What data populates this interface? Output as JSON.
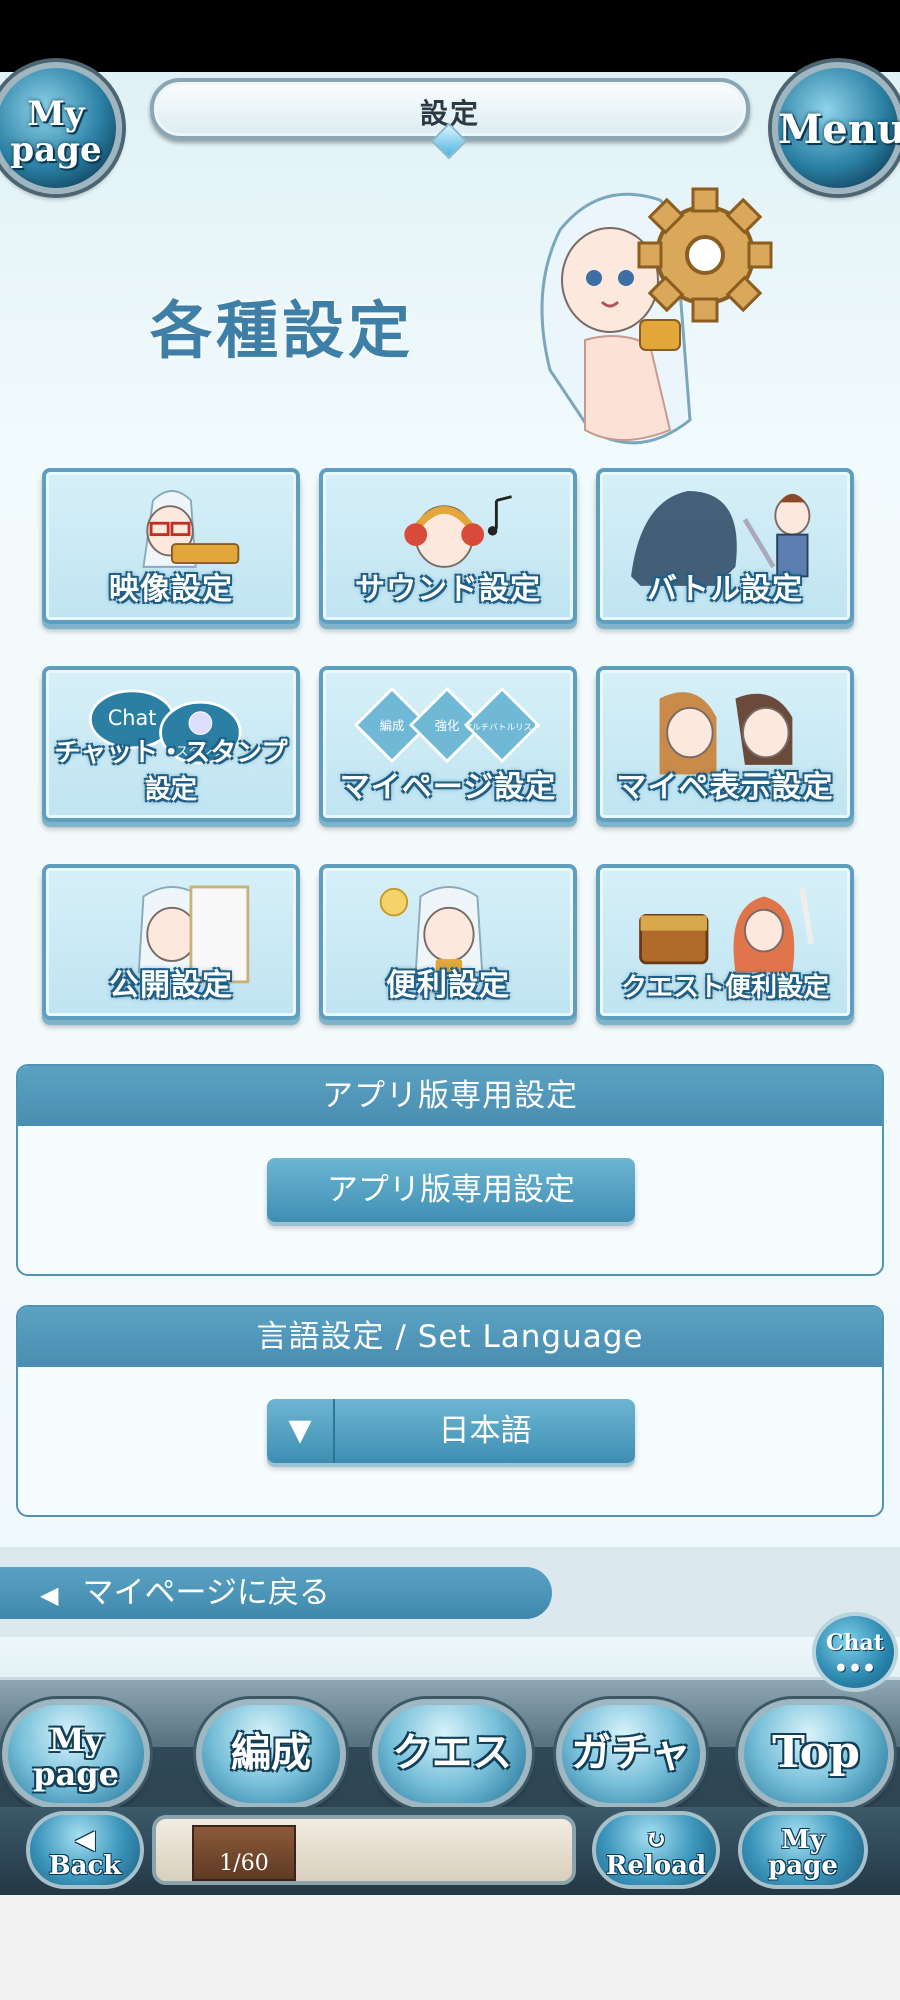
{
  "header": {
    "title": "設定",
    "mypage_orb": [
      "My",
      "page"
    ],
    "menu_orb": "Menu"
  },
  "hero": {
    "title": "各種設定"
  },
  "tiles": [
    {
      "label": "映像設定",
      "icon": "glasses-character-icon"
    },
    {
      "label": "サウンド設定",
      "icon": "headphones-character-icon"
    },
    {
      "label": "バトル設定",
      "icon": "battle-characters-icon"
    },
    {
      "label": "チャット・スタンプ設定",
      "icon": "chat-stamp-icon",
      "chat": "Chat",
      "stamp": "スタンプ"
    },
    {
      "label": "マイページ設定",
      "icon": "mypage-diamonds-icon",
      "diamonds": [
        "編成",
        "強化",
        "マルチバトルリスト"
      ]
    },
    {
      "label": "マイペ表示設定",
      "icon": "two-characters-icon"
    },
    {
      "label": "公開設定",
      "icon": "peeking-character-icon"
    },
    {
      "label": "便利設定",
      "icon": "lightbulb-character-icon"
    },
    {
      "label": "クエスト便利設定",
      "icon": "treasure-chest-icon"
    }
  ],
  "app_panel": {
    "heading": "アプリ版専用設定",
    "button": "アプリ版専用設定"
  },
  "language_panel": {
    "heading": "言語設定 / Set Language",
    "selected": "日本語",
    "arrow": "▼"
  },
  "back_link": {
    "arrow": "◀",
    "label": "マイページに戻る"
  },
  "chat_bubble": "Chat",
  "footer": {
    "nav": {
      "mypage": [
        "My",
        "page"
      ],
      "party": "編成",
      "quest": "クエスト",
      "gacha": "ガチャ",
      "top": "Top"
    },
    "sub": {
      "back": [
        "◀",
        "Back"
      ],
      "reload": [
        "↻",
        "Reload"
      ],
      "mypage": [
        "My",
        "page"
      ]
    },
    "stamina": "1/60"
  },
  "colors": {
    "accent": "#4a8db0",
    "tile_border": "#5e9fbf",
    "title_text": "#3d7fa6"
  }
}
